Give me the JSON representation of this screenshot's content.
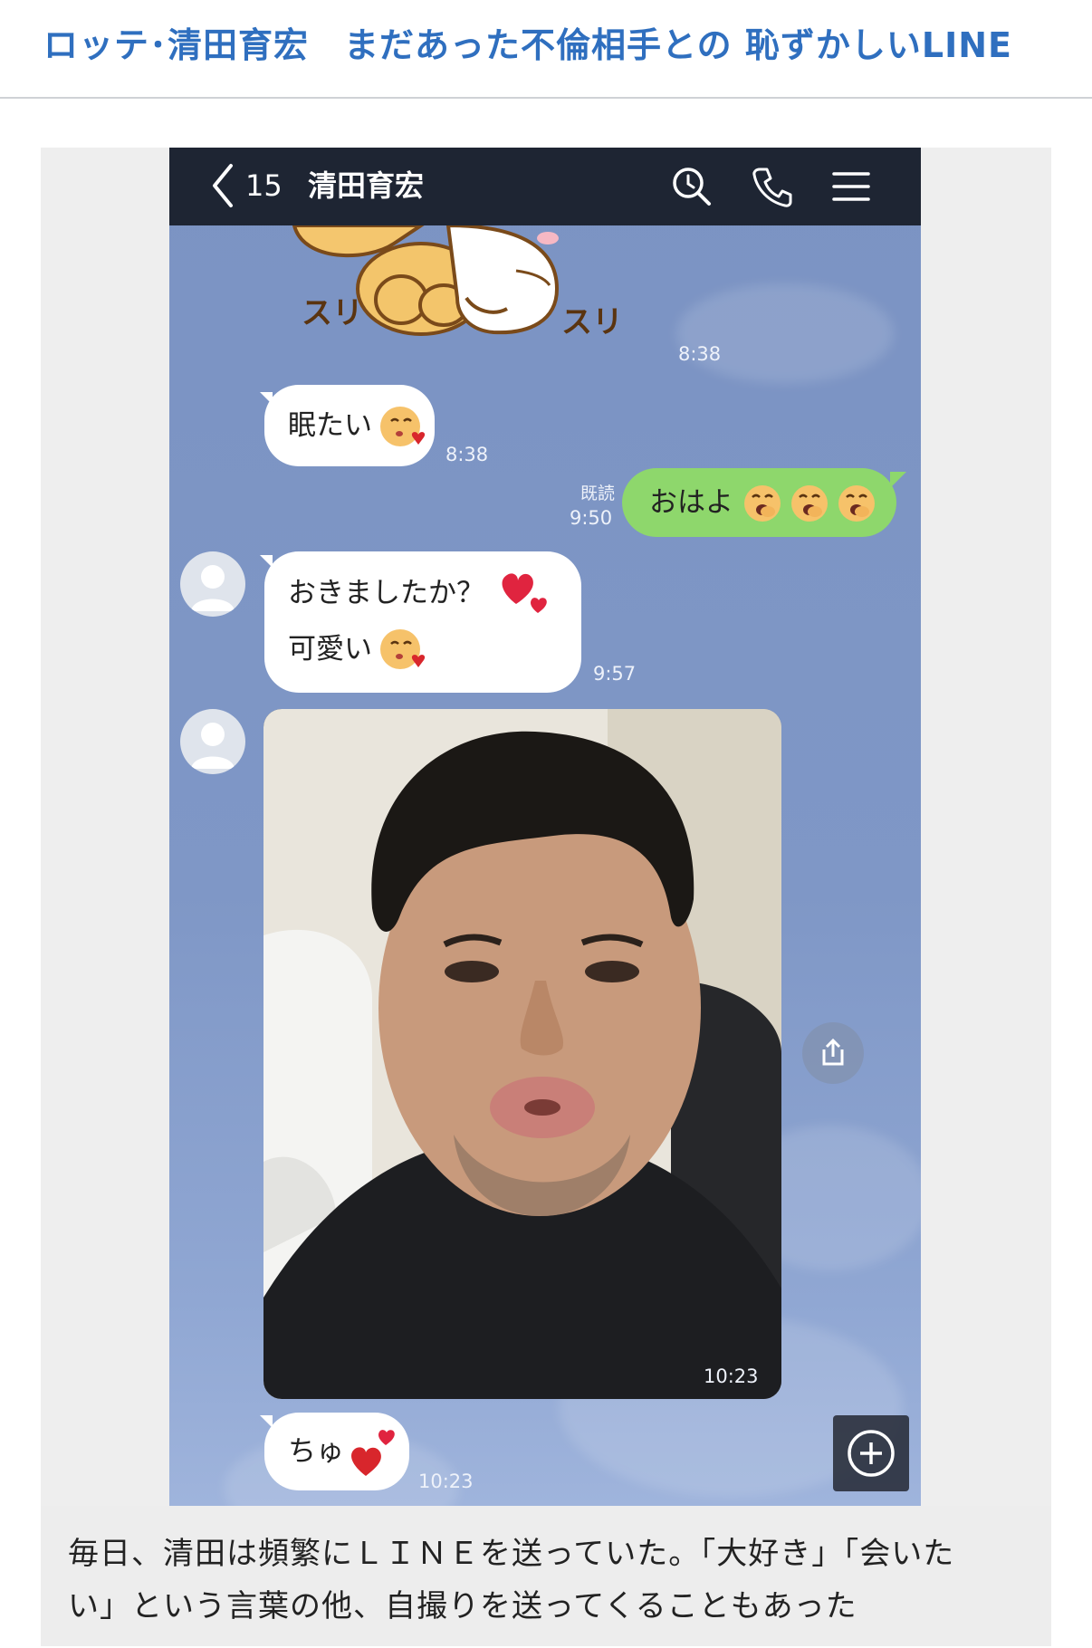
{
  "article": {
    "headline": "ロッテ･清田育宏　まだあった不倫相手との 恥ずかしいLINE"
  },
  "chat": {
    "header": {
      "unread_count": "15",
      "contact_name": "清田育宏",
      "icons": [
        "back-chevron-icon",
        "search-icon",
        "phone-icon",
        "menu-icon"
      ]
    },
    "messages": [
      {
        "type": "sticker",
        "caption_left": "スリ",
        "caption_right": "スリ",
        "time": "8:38"
      },
      {
        "type": "text",
        "from": "them",
        "text": "眠たい",
        "emoji": "kissing-heart-emoji",
        "time": "8:38"
      },
      {
        "type": "text",
        "from": "me",
        "text": "おはよ",
        "emoji": [
          "yawning-emoji",
          "yawning-emoji",
          "yawning-emoji"
        ],
        "read": "既読",
        "time": "9:50"
      },
      {
        "type": "text",
        "from": "them",
        "lines": [
          "おきましたか？",
          "可愛い"
        ],
        "emoji": [
          "two-hearts-emoji",
          "kissing-heart-emoji"
        ],
        "time": "9:57"
      },
      {
        "type": "image",
        "from": "them",
        "description_icon": "selfie-photo",
        "time": "10:23"
      },
      {
        "type": "text",
        "from": "them",
        "text": "ちゅ",
        "emoji": "heart-emoji",
        "time": "10:23"
      }
    ],
    "controls": {
      "share": "share-icon",
      "add": "plus-icon"
    },
    "colors": {
      "navbar": "#1e2533",
      "background": "#7f97c6",
      "my_bubble": "#8ed76c",
      "their_bubble": "#ffffff",
      "headline": "#2f6fbf"
    }
  },
  "caption": {
    "line1": "毎日、清田は頻繁にＬＩＮＥを送っていた。「大好き」「会いた",
    "line2": "い」という言葉の他、自撮りを送ってくることもあった"
  }
}
